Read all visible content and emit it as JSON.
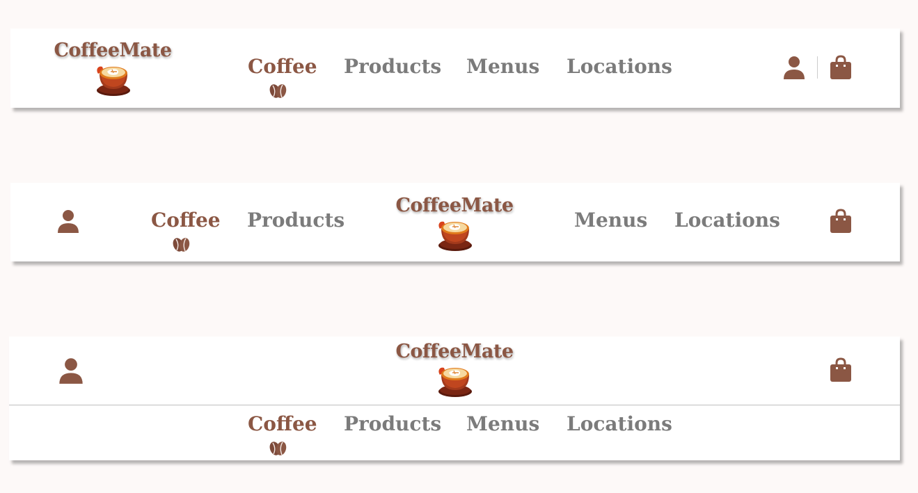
{
  "brand": {
    "name": "CoffeeMate"
  },
  "nav": {
    "items": [
      {
        "label": "Coffee",
        "active": true
      },
      {
        "label": "Products",
        "active": false
      },
      {
        "label": "Menus",
        "active": false
      },
      {
        "label": "Locations",
        "active": false
      }
    ]
  },
  "icons": {
    "user": "user-icon",
    "bag": "shopping-bag-icon",
    "bean": "coffee-bean-icon",
    "cup": "coffee-cup-icon"
  },
  "colors": {
    "background": "#fdf9f8",
    "brand": "#8b5744",
    "nav_text": "#7b7b7b",
    "bar": "#ffffff"
  }
}
